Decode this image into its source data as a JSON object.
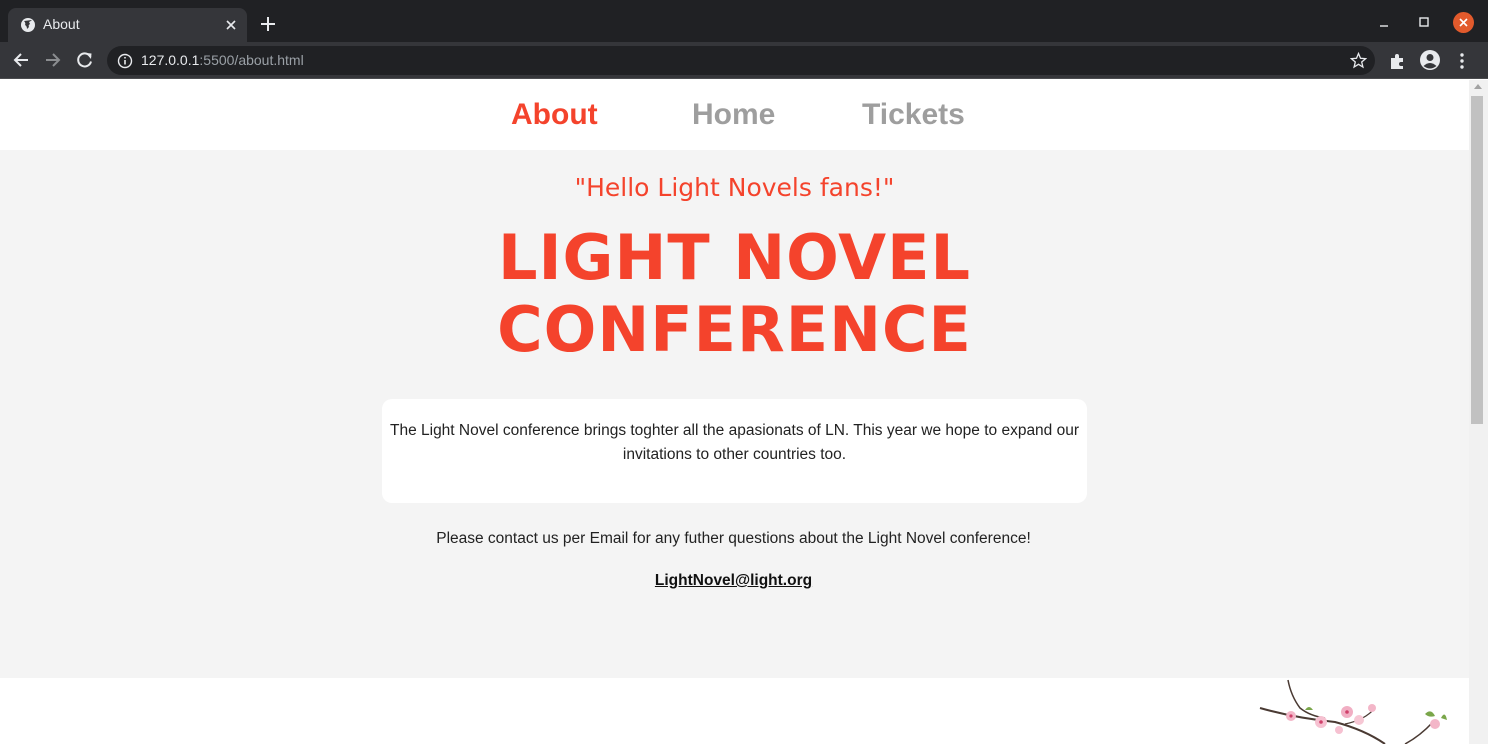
{
  "browser": {
    "tab": {
      "title": "About"
    },
    "address": {
      "host": "127.0.0.1",
      "path": ":5500/about.html"
    }
  },
  "site": {
    "nav": [
      {
        "label": "About",
        "active": true
      },
      {
        "label": "Home",
        "active": false
      },
      {
        "label": "Tickets",
        "active": false
      }
    ],
    "tagline": "\"Hello Light Novels fans!\"",
    "headline_line1": "LIGHT NOVEL",
    "headline_line2": "CONFERENCE",
    "about_text": "The Light Novel conference brings toghter all the apasionats of LN. This year we hope to expand our invitations to other countries too.",
    "contact_text": "Please contact us per Email for any futher questions about the Light Novel conference!",
    "email": "LightNovel@light.org"
  },
  "colors": {
    "accent": "#f4432c",
    "nav_inactive": "#9e9e9e",
    "hero_bg": "#f4f4f4",
    "chrome_dark": "#202124",
    "chrome_toolbar": "#35363a"
  },
  "icons": [
    "globe-icon",
    "close-icon",
    "plus-icon",
    "back-arrow-icon",
    "forward-arrow-icon",
    "reload-icon",
    "info-icon",
    "star-icon",
    "puzzle-icon",
    "profile-icon",
    "kebab-menu-icon",
    "minimize-icon",
    "maximize-icon",
    "window-close-icon"
  ]
}
